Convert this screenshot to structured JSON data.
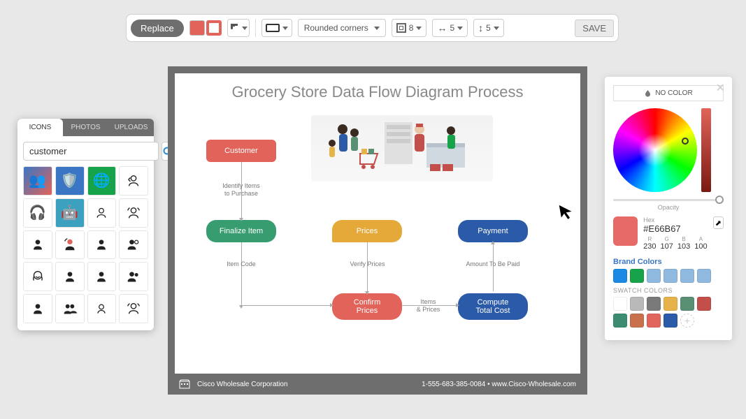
{
  "toolbar": {
    "replace": "Replace",
    "fill_color": "#e16359",
    "stroke_color": "#e16359",
    "shape_style": "Rounded corners",
    "border_weight": "8",
    "width_val": "5",
    "height_val": "5",
    "save": "SAVE"
  },
  "icons_panel": {
    "tabs": [
      "ICONS",
      "PHOTOS",
      "UPLOADS"
    ],
    "active_tab": 0,
    "search_value": "customer"
  },
  "diagram": {
    "title": "Grocery Store Data Flow Diagram Process",
    "boxes": {
      "customer": "Customer",
      "finalize": "Finalize Item",
      "prices": "Prices",
      "payment": "Payment",
      "confirm": "Confirm\nPrices",
      "compute": "Compute\nTotal Cost"
    },
    "labels": {
      "identify": "Identify Items\nto Purchase",
      "item_code": "Item Code",
      "verify": "Verify Prices",
      "amount": "Amount To Be Paid",
      "items_prices": "Items\n& Prices"
    },
    "footer_company": "Cisco Wholesale Corporation",
    "footer_contact": "1-555-683-385-0084 • www.Cisco-Wholesale.com"
  },
  "color_panel": {
    "no_color": "NO COLOR",
    "opacity_label": "Opacity",
    "hex_label": "Hex",
    "hex_value": "#E66B67",
    "rgba": {
      "R": "230",
      "G": "107",
      "B": "103",
      "A": "100"
    },
    "brand_label": "Brand Colors",
    "brand_colors": [
      "#1a8ae5",
      "#17a34a",
      "#8fb9df",
      "#8fb9df",
      "#8fb9df",
      "#8fb9df"
    ],
    "swatch_label": "SWATCH COLORS",
    "swatch_colors": [
      "#ffffff",
      "#b9b9b9",
      "#7a7a7a",
      "#e6b24a",
      "#598f73",
      "#c34f4a",
      "#3c8c72",
      "#c9714c",
      "#e1655c",
      "#2a5aa8"
    ]
  }
}
